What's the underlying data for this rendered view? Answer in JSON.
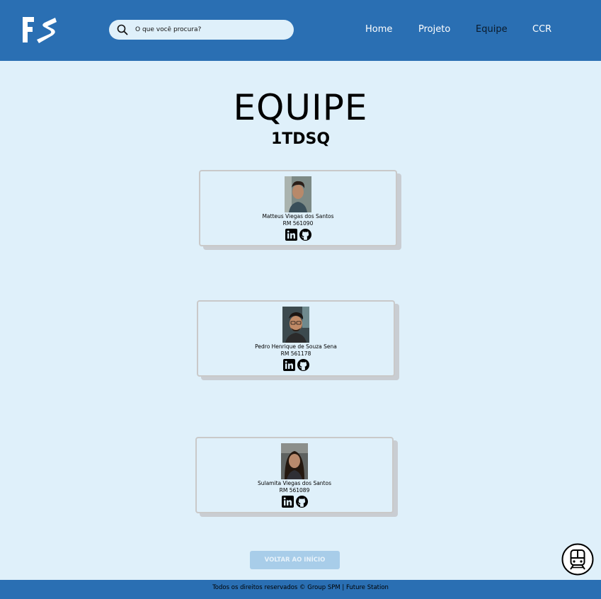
{
  "brand": {
    "logo_text": "FS"
  },
  "search": {
    "placeholder": "O que você procura?"
  },
  "nav": {
    "items": [
      {
        "label": "Home",
        "active": false
      },
      {
        "label": "Projeto",
        "active": false
      },
      {
        "label": "Equipe",
        "active": true
      },
      {
        "label": "CCR",
        "active": false
      }
    ]
  },
  "page": {
    "title": "EQUIPE",
    "subtitle": "1TDSQ"
  },
  "team": [
    {
      "name": "Matteus Viegas dos Santos",
      "rm": "RM 561090",
      "icons": [
        "linkedin-icon",
        "github-icon"
      ]
    },
    {
      "name": "Pedro Henrique de Souza Sena",
      "rm": "RM 561178",
      "icons": [
        "linkedin-icon",
        "github-icon"
      ]
    },
    {
      "name": "Sulamita Viegas dos Santos",
      "rm": "RM 561089",
      "icons": [
        "linkedin-icon",
        "github-icon"
      ]
    }
  ],
  "back_button": {
    "label": "VOLTAR AO INÍCIO"
  },
  "footer": {
    "text": "Todos os direitos reservados © Group SPM | Future Station"
  },
  "colors": {
    "header": "#2a6fb3",
    "background": "#dff0fa",
    "button": "#a8cde9"
  }
}
